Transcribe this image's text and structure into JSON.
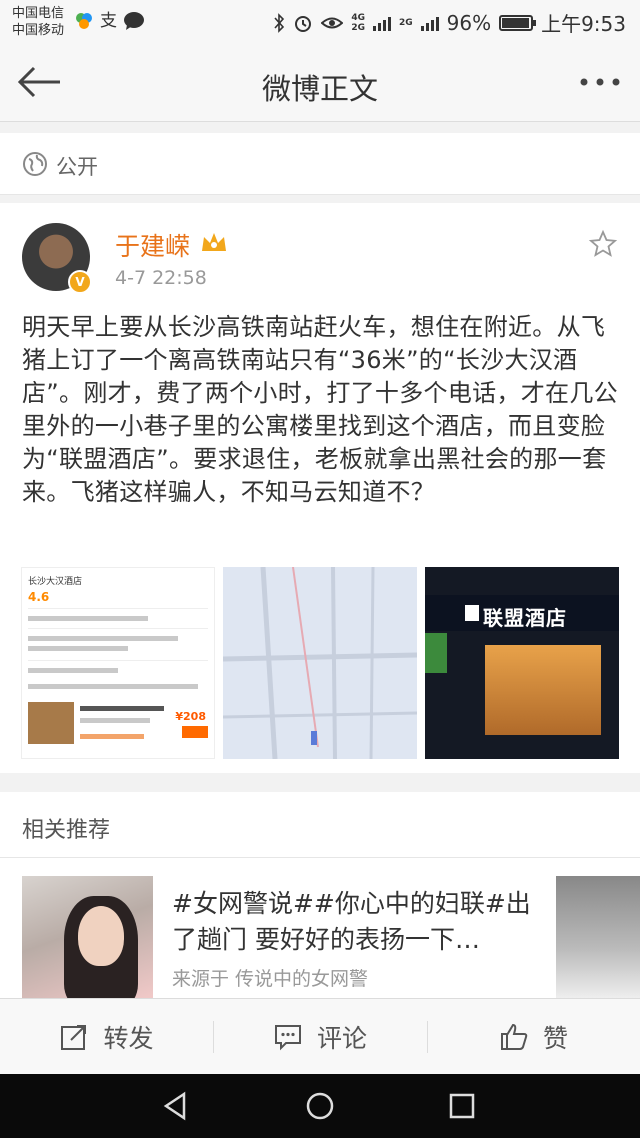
{
  "status_bar": {
    "carrier_1": "中国电信",
    "carrier_2": "中国移动",
    "net_1": "4G",
    "net_2": "2G",
    "net_3": "2G",
    "battery": "96%",
    "battery_level": 0.96,
    "time": "上午9:53"
  },
  "header": {
    "title": "微博正文",
    "back_icon": "arrow-left-icon",
    "more_icon": "more-dots-icon"
  },
  "visibility": {
    "icon": "globe-icon",
    "label": "公开"
  },
  "post": {
    "author": "于建嵘",
    "time": "4-7 22:58",
    "text": "明天早上要从长沙高铁南站赶火车，想住在附近。从飞猪上订了一个离高铁南站只有“36米”的“长沙大汉酒店”。刚才，费了两个小时，打了十多个电话，才在几公里外的一小巷子里的公寓楼里找到这个酒店，而且变脸为“联盟酒店”。要求退住，老板就拿出黑社会的那一套来。飞猪这样骗人，不知马云知道不？",
    "images": {
      "img1_title": "长沙大汉酒店",
      "img1_score": "4.6",
      "img1_price": "¥208",
      "img3_sign": "联盟酒店"
    }
  },
  "related": {
    "header": "相关推荐",
    "title": "#女网警说##你心中的妇联#出了趟门 要好好的表扬一下…",
    "source": "来源于 传说中的女网警"
  },
  "actions": {
    "repost": "转发",
    "comment": "评论",
    "like": "赞"
  },
  "colors": {
    "author_name": "#e8731a",
    "vip_badge": "#f2a71b"
  }
}
